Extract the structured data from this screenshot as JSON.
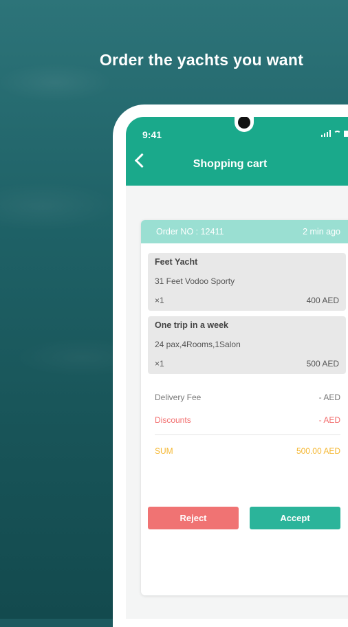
{
  "headline": "Order the yachts you want",
  "status_bar": {
    "time": "9:41"
  },
  "header": {
    "title": "Shopping cart"
  },
  "order": {
    "number_label": "Order NO : 12411",
    "time_ago": "2 min ago",
    "items": [
      {
        "name": "Feet Yacht",
        "description": "31 Feet Vodoo Sporty",
        "quantity": "×1",
        "price": "400 AED"
      },
      {
        "name": "One trip in a week",
        "description": "24 pax,4Rooms,1Salon",
        "quantity": "×1",
        "price": "500 AED"
      }
    ],
    "delivery_fee": {
      "label": "Delivery Fee",
      "value": "- AED"
    },
    "discounts": {
      "label": "Discounts",
      "value": "- AED"
    },
    "sum": {
      "label": "SUM",
      "value": "500.00 AED"
    }
  },
  "buttons": {
    "reject": "Reject",
    "accept": "Accept"
  },
  "colors": {
    "primary": "#1aa98b",
    "header_tint": "#9adfd2",
    "reject": "#f07373",
    "accept": "#2bb49a",
    "discount": "#f26e6e",
    "sum": "#f5b731"
  }
}
